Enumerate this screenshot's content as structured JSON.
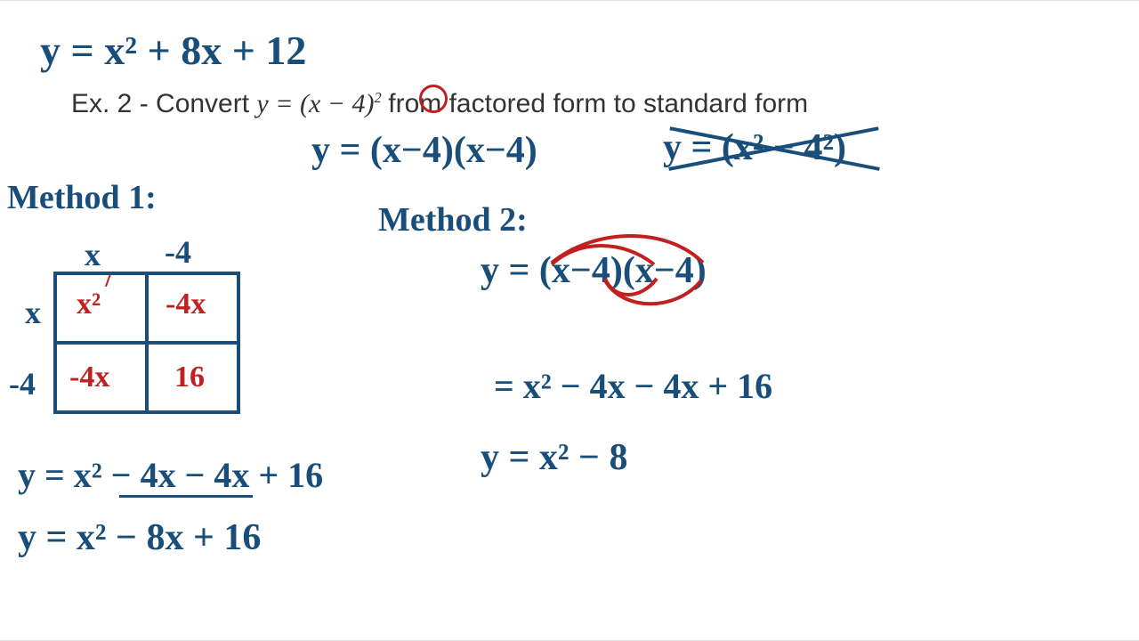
{
  "topEquation": "y = x² + 8x + 12",
  "exampleLabel": "Ex. 2 - Convert ",
  "exampleEquation": "y = (x − 4)",
  "exampleExponent": "2",
  "exampleTail": " from factored form to standard form",
  "expandedFactored": "y = (x−4)(x−4)",
  "wrongExpansion": "y = (x² − 4²)",
  "method1Label": "Method 1:",
  "method2Label": "Method 2:",
  "areaModel": {
    "colHeaders": [
      "x",
      "-4"
    ],
    "rowHeaders": [
      "x",
      "-4"
    ],
    "cells": [
      [
        "x²",
        "-4x"
      ],
      [
        "-4x",
        "16"
      ]
    ]
  },
  "m1Step1": "y = x² − 4x − 4x + 16",
  "m1Step2": "y = x² − 8x + 16",
  "m2Factored": "y = (x−4)(x−4)",
  "m2Step1": "= x² − 4x − 4x + 16",
  "m2Step2": "y = x² − 8"
}
